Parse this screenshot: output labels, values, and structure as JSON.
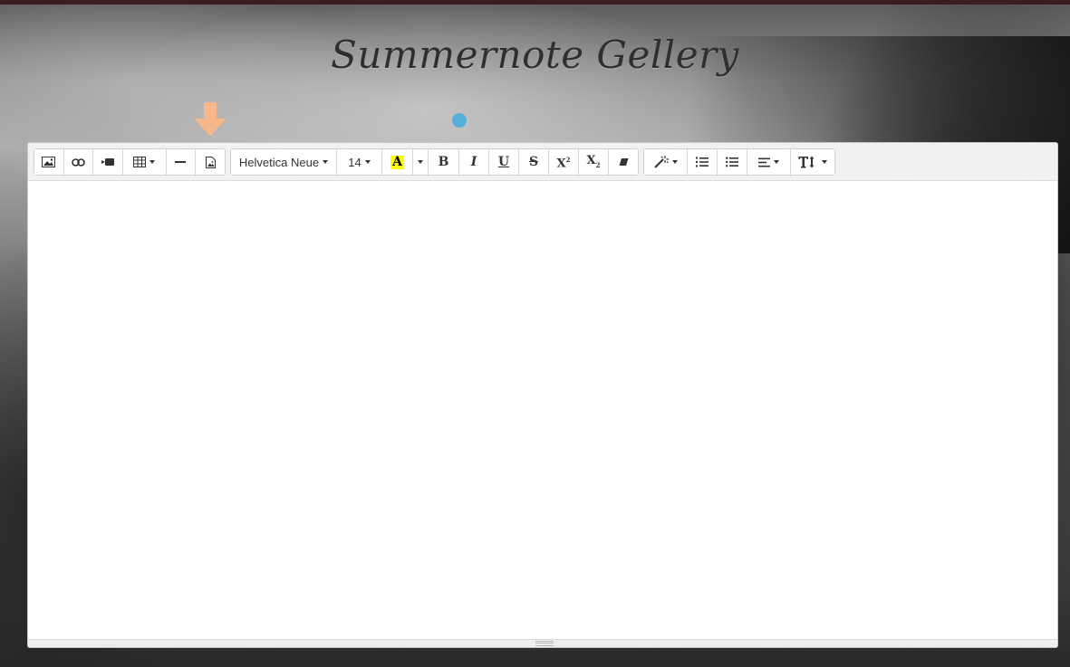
{
  "page": {
    "title": "Summernote Gellery"
  },
  "toolbar": {
    "insert_group": [
      {
        "icon": "picture-icon"
      },
      {
        "icon": "link-icon"
      },
      {
        "icon": "video-icon"
      },
      {
        "icon": "table-icon",
        "dropdown": true
      },
      {
        "icon": "horizontal-rule-icon"
      },
      {
        "icon": "gallery-image-icon"
      }
    ],
    "font_name": "Helvetica Neue",
    "font_size": "14",
    "color_button_label": "A",
    "highlight_color": "#ffff00",
    "bold_label": "B",
    "italic_label": "I",
    "underline_label": "U",
    "strikethrough_label": "S",
    "superscript_label": "X",
    "subscript_label": "X",
    "paragraph_group": [
      {
        "icon": "magic-style-icon",
        "dropdown": true
      },
      {
        "icon": "ordered-list-icon"
      },
      {
        "icon": "unordered-list-icon"
      },
      {
        "icon": "align-left-icon",
        "dropdown": true
      },
      {
        "icon": "text-height-icon",
        "dropdown": true
      }
    ]
  },
  "editor": {
    "content": ""
  },
  "colors": {
    "arrow_indicator": "#f6b78a",
    "cursor_dot": "#56afd8",
    "title_text": "#2f2f2f"
  }
}
